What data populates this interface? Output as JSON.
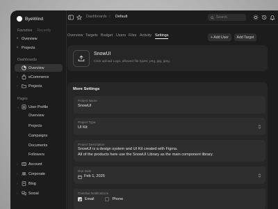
{
  "brand": {
    "name": "ByeWind"
  },
  "sidebar": {
    "tabs": [
      "Favorites",
      "Recently"
    ],
    "favorites": [
      "Overview",
      "Projects"
    ],
    "dashboards_title": "Dashboards",
    "dashboards": [
      "Overview",
      "eCommerce",
      "Projects"
    ],
    "pages_title": "Pages",
    "user_profile": "User Profile",
    "user_profile_sub": [
      "Overview",
      "Projects",
      "Campaigns",
      "Documents",
      "Followers"
    ],
    "pages": [
      "Account",
      "Corporate",
      "Blog",
      "Social"
    ]
  },
  "topbar": {
    "breadcrumb": [
      "Dashboards",
      "/",
      "Default"
    ],
    "search_placeholder": "Search"
  },
  "tabs": [
    "Overview",
    "Targets",
    "Budget",
    "Users",
    "Files",
    "Activity",
    "Settings"
  ],
  "active_tab": "Settings",
  "actions": {
    "add_user": "+ Add User",
    "add_target": "Add Target"
  },
  "header_card": {
    "title": "SnowUI",
    "subtitle": "Click upload Logo, allowed file types: png, jpg, jpeg."
  },
  "settings": {
    "title": "More Settings",
    "project_name": {
      "label": "Project Name",
      "value": "SnowUI"
    },
    "project_type": {
      "label": "Project Type",
      "value": "UI Kit"
    },
    "project_description": {
      "label": "Project Description",
      "line1": "SnowUI is a design system and UI Kit created with Figma.",
      "line2": "All of the products here use the SnowUI Library as the main component library."
    },
    "due_date": {
      "label": "Due Date",
      "value": "Feb 1, 2025"
    },
    "notifications": {
      "label": "Overdue Notifications",
      "options": [
        "Email",
        "Phone"
      ],
      "email_checked": true,
      "phone_checked": false
    }
  },
  "colors": {
    "background": "#1c1c1c",
    "card": "#262626",
    "field": "#2e2e2e",
    "accent": "#ffffff"
  }
}
